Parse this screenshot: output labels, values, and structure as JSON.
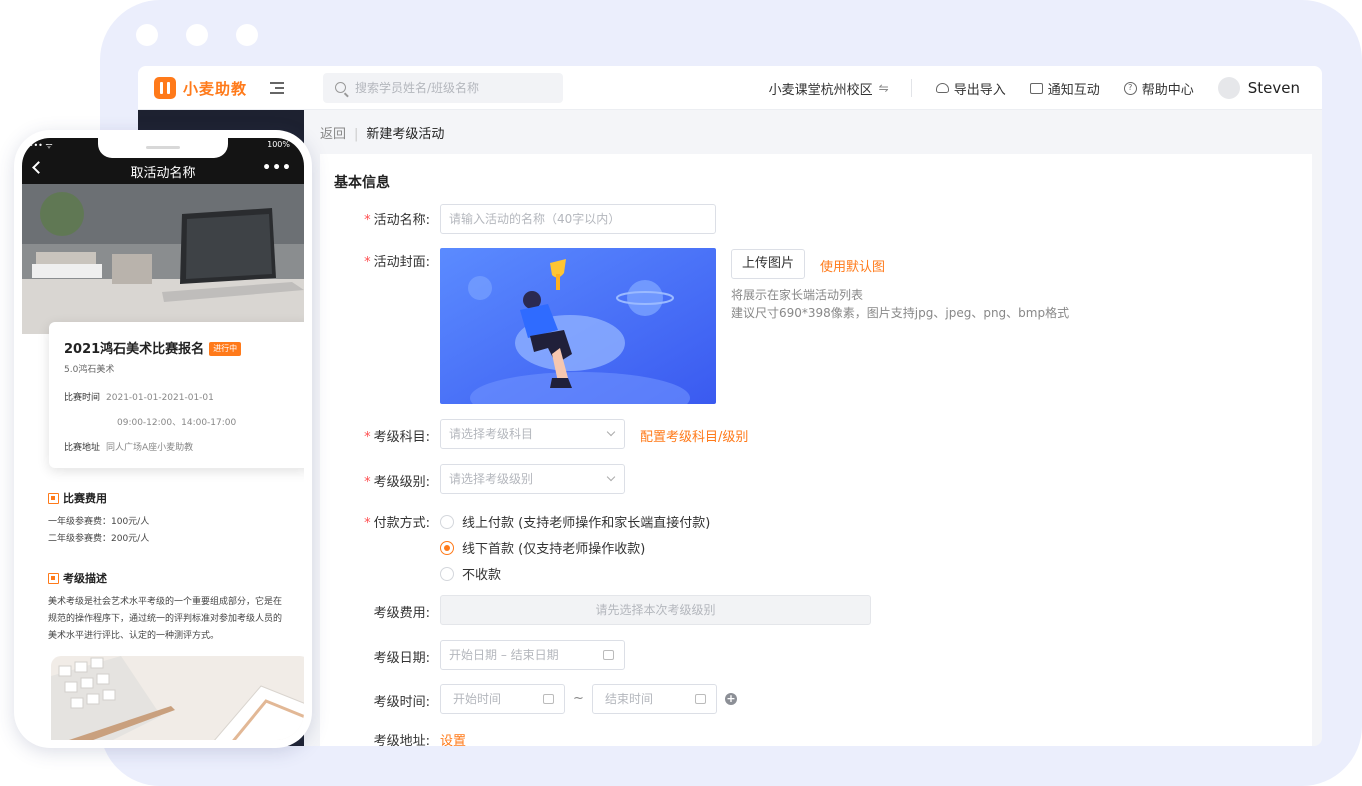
{
  "header": {
    "brand": "小麦助教",
    "search_placeholder": "搜索学员姓名/班级名称",
    "campus": "小麦课堂杭州校区",
    "swap_glyph": "⇋",
    "export_import": "导出导入",
    "notice": "通知互动",
    "help": "帮助中心",
    "user": "Steven"
  },
  "breadcrumb": {
    "back": "返回",
    "current": "新建考级活动"
  },
  "form": {
    "section_title": "基本信息",
    "required_mark": "*",
    "name_label": "活动名称:",
    "name_placeholder": "请输入活动的名称（40字以内）",
    "cover_label": "活动封面:",
    "upload_button": "上传图片",
    "use_default": "使用默认图",
    "cover_hint_1": "将展示在家长端活动列表",
    "cover_hint_2": "建议尺寸690*398像素，图片支持jpg、jpeg、png、bmp格式",
    "subject_label": "考级科目:",
    "subject_placeholder": "请选择考级科目",
    "config_link": "配置考级科目/级别",
    "level_label": "考级级别:",
    "level_placeholder": "请选择考级级别",
    "payment_label": "付款方式:",
    "payment_options": [
      {
        "label": "线上付款 (支持老师操作和家长端直接付款)",
        "selected": false
      },
      {
        "label": "线下首款 (仅支持老师操作收款)",
        "selected": true
      },
      {
        "label": "不收款",
        "selected": false
      }
    ],
    "fee_label": "考级费用:",
    "fee_placeholder": "请先选择本次考级级别",
    "date_label": "考级日期:",
    "date_placeholder": "开始日期 – 结束日期",
    "time_label": "考级时间:",
    "time_start_placeholder": "开始时间",
    "time_tilde": "~",
    "time_end_placeholder": "结束时间",
    "address_label": "考级地址:",
    "address_link": "设置"
  },
  "phone": {
    "status_left": "•••• ᯤ",
    "status_right": "100%",
    "nav_title": "取活动名称",
    "more": "•••",
    "card": {
      "title": "2021鸿石美术比赛报名",
      "badge": "进行中",
      "subtitle": "5.0鸿石美术",
      "time_label": "比赛时间",
      "time_value": "2021-01-01-2021-01-01",
      "time_value_2": "09:00-12:00、14:00-17:00",
      "addr_label": "比赛地址",
      "addr_value": "同人广场A座小麦助教"
    },
    "fee_title": "比赛费用",
    "fee_lines": [
      "一年级参赛费：100元/人",
      "二年级参赛费：200元/人"
    ],
    "desc_title": "考级描述",
    "desc_lines": [
      "美术考级是社会艺术水平考级的一个重要组成部分，它是在",
      "规范的操作程序下，通过统一的评判标准对参加考级人员的",
      "美术水平进行评比、认定的一种测评方式。"
    ]
  },
  "colors": {
    "accent": "#ff7a1a",
    "frame": "#ebeefc",
    "sidebar": "#1d2130"
  }
}
